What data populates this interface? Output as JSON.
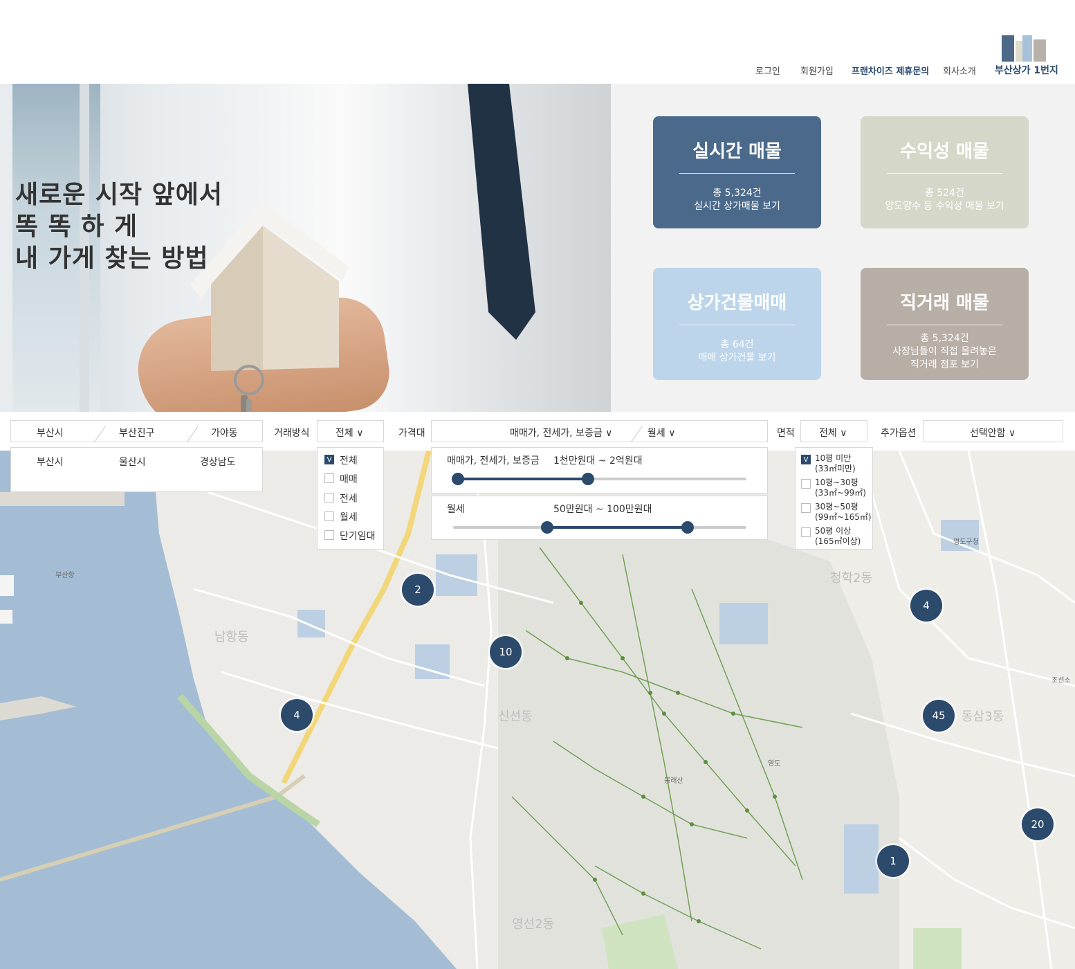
{
  "header": {
    "nav": [
      "로그인",
      "회원가입",
      "프랜차이즈 제휴문의",
      "회사소개",
      "부산상가 1번지"
    ],
    "logo_colors": [
      "#4c6a88",
      "#a7c2d8",
      "#e0dccd",
      "#b8b1a9"
    ]
  },
  "hero": {
    "line1": "새로운 시작 앞에서",
    "line2": "똑 똑 하 게",
    "line3": "내 가게 찾는 방법"
  },
  "cards": [
    {
      "title": "실시간 매물",
      "sub1": "총 5,324건",
      "sub2": "실시간 상가매물 보기",
      "color": "#4b6a8b"
    },
    {
      "title": "수익성 매물",
      "sub1": "총 524건",
      "sub2": "양도양수 등 수익성 매물 보기",
      "color": "#d5d7c8"
    },
    {
      "title": "상가건물매매",
      "sub1": "총 64건",
      "sub2": "매매 상가건물 보기",
      "color": "#bcd5ea"
    },
    {
      "title": "직거래 매물",
      "sub1": "총 5,324건",
      "sub2": "사장님들이 직접 올려놓은",
      "sub3": "직거래 점포 보기",
      "color": "#b7aea6"
    }
  ],
  "filters": {
    "region": [
      "부산시",
      "부산진구",
      "가야동"
    ],
    "region_options": [
      "부산시",
      "울산시",
      "경상남도"
    ],
    "trade_label": "거래방식",
    "trade_value": "전체 ∨",
    "trade_options": [
      "전체",
      "매매",
      "전세",
      "월세",
      "단기임대"
    ],
    "price_label": "가격대",
    "price_value1": "매매가, 전세가, 보증금 ∨",
    "price_value2": "월세 ∨",
    "price_slider1_label": "매매가, 전세가, 보증금",
    "price_slider1_range": "1천만원대 ~ 2억원대",
    "price_slider1_min": 0.0,
    "price_slider1_max": 0.45,
    "price_slider2_label": "월세",
    "price_slider2_range": "50만원대 ~ 100만원대",
    "price_slider2_min": 0.32,
    "price_slider2_max": 0.8,
    "area_label": "면적",
    "area_value": "전체 ∨",
    "area_options": [
      [
        "10평 미만",
        "(33㎡미만)"
      ],
      [
        "10평~30평",
        "(33㎡~99㎡)"
      ],
      [
        "30평~50평",
        "(99㎡~165㎡)"
      ],
      [
        "50평 이상",
        "(165㎡이상)"
      ]
    ],
    "extra_label": "추가옵션",
    "extra_value": "선택안함 ∨",
    "check_mark": "V"
  },
  "map": {
    "pins": [
      "2",
      "10",
      "4",
      "4",
      "45",
      "20",
      "1"
    ],
    "labels": [
      "남항동",
      "신선동",
      "청학2동",
      "동삼3동",
      "영선2동",
      "봉래산",
      "영도구청",
      "부산항",
      "영도",
      "조선소"
    ]
  }
}
